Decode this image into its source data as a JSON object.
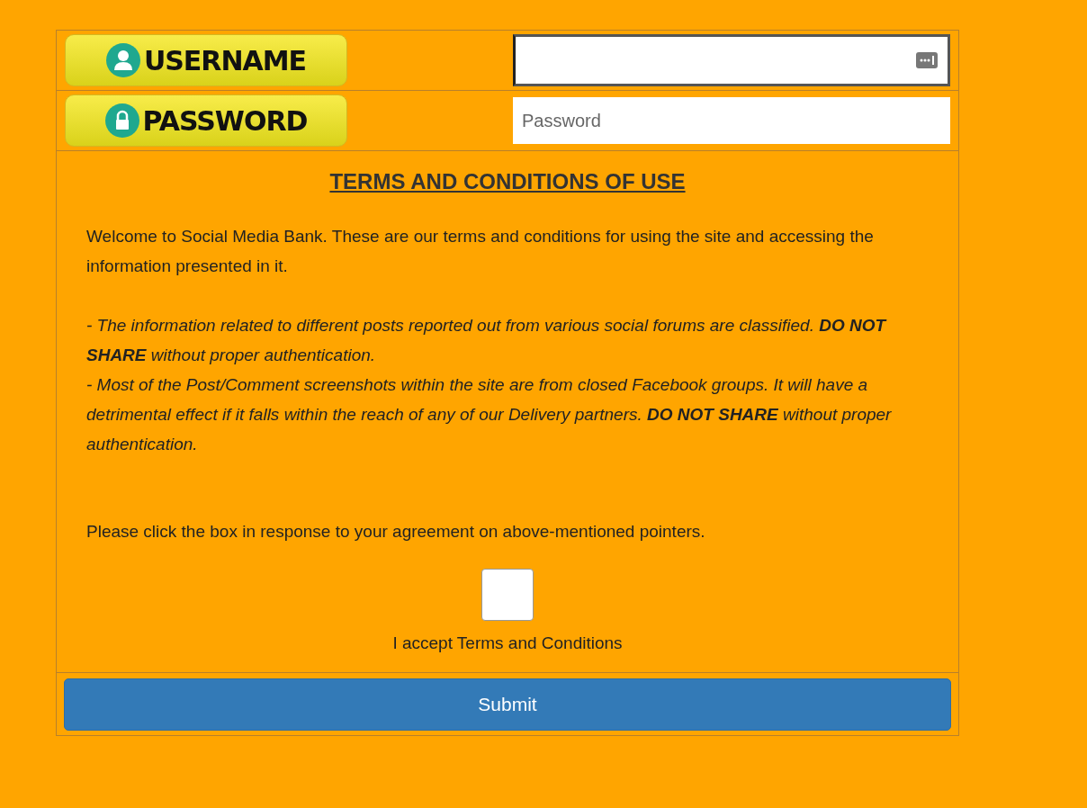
{
  "fields": [
    {
      "kind": "user",
      "label": "USERNAME",
      "focused": true
    },
    {
      "kind": "lock",
      "label": "PASSWORD",
      "focused": false,
      "placeholder": "Password"
    }
  ],
  "terms": {
    "title": "TERMS AND CONDITIONS OF USE",
    "intro": "Welcome to Social Media Bank. These are our terms and conditions for using the site and accessing the information presented in it.",
    "points": [
      "- The information related to different posts reported out from various social forums are classified. **DO NOT SHARE** without proper authentication.",
      "- Most of the Post/Comment screenshots within the site are from closed Facebook groups. It will have a detrimental effect if it falls within the reach of any of our Delivery partners. **DO NOT SHARE** without proper authentication."
    ],
    "prompt": "Please click the box in response to your agreement on above-mentioned pointers.",
    "checkbox": {
      "checked": false,
      "label": "I accept Terms and Conditions"
    }
  },
  "submit": "Submit"
}
